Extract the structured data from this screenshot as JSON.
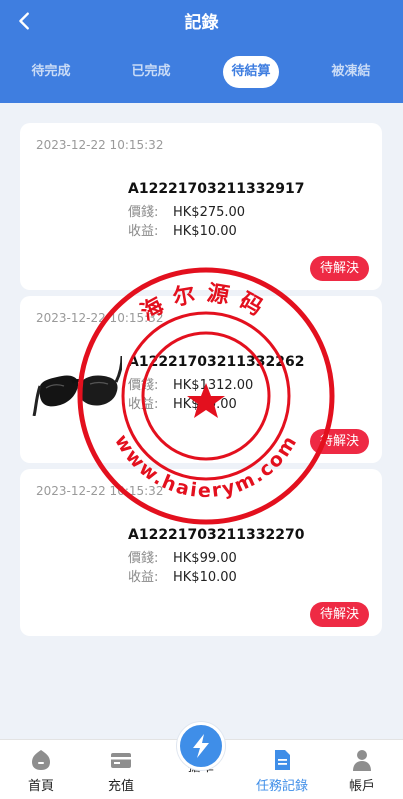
{
  "header": {
    "title": "記錄"
  },
  "tabs": [
    {
      "label": "待完成"
    },
    {
      "label": "已完成"
    },
    {
      "label": "待結算"
    },
    {
      "label": "被凍結"
    }
  ],
  "orders": [
    {
      "time": "2023-12-22 10:15:32",
      "id": "A12221703211332917",
      "price_label": "價錢:",
      "price": "HK$275.00",
      "profit_label": "收益:",
      "profit": "HK$10.00",
      "status": "待解決"
    },
    {
      "time": "2023-12-22 10:15:32",
      "id": "A12221703211332262",
      "price_label": "價錢:",
      "price": "HK$1312.00",
      "profit_label": "收益:",
      "profit": "HK$10.00",
      "status": "待解決"
    },
    {
      "time": "2023-12-22 10:15:32",
      "id": "A12221703211332270",
      "price_label": "價錢:",
      "price": "HK$99.00",
      "profit_label": "收益:",
      "profit": "HK$10.00",
      "status": "待解決"
    }
  ],
  "stamp": {
    "top_text": "海尔源码",
    "bottom_text": "www.haierym.com"
  },
  "tabbar": [
    {
      "label": "首頁",
      "icon": "home-icon"
    },
    {
      "label": "充值",
      "icon": "card-icon"
    },
    {
      "label": "搶單",
      "icon": "lightning-icon"
    },
    {
      "label": "任務記錄",
      "icon": "document-icon"
    },
    {
      "label": "帳戶",
      "icon": "user-icon"
    }
  ],
  "colors": {
    "header": "#3f7ee0",
    "status": "#ee2a44",
    "accent": "#3f8ee8",
    "stamp": "#e3101e"
  }
}
